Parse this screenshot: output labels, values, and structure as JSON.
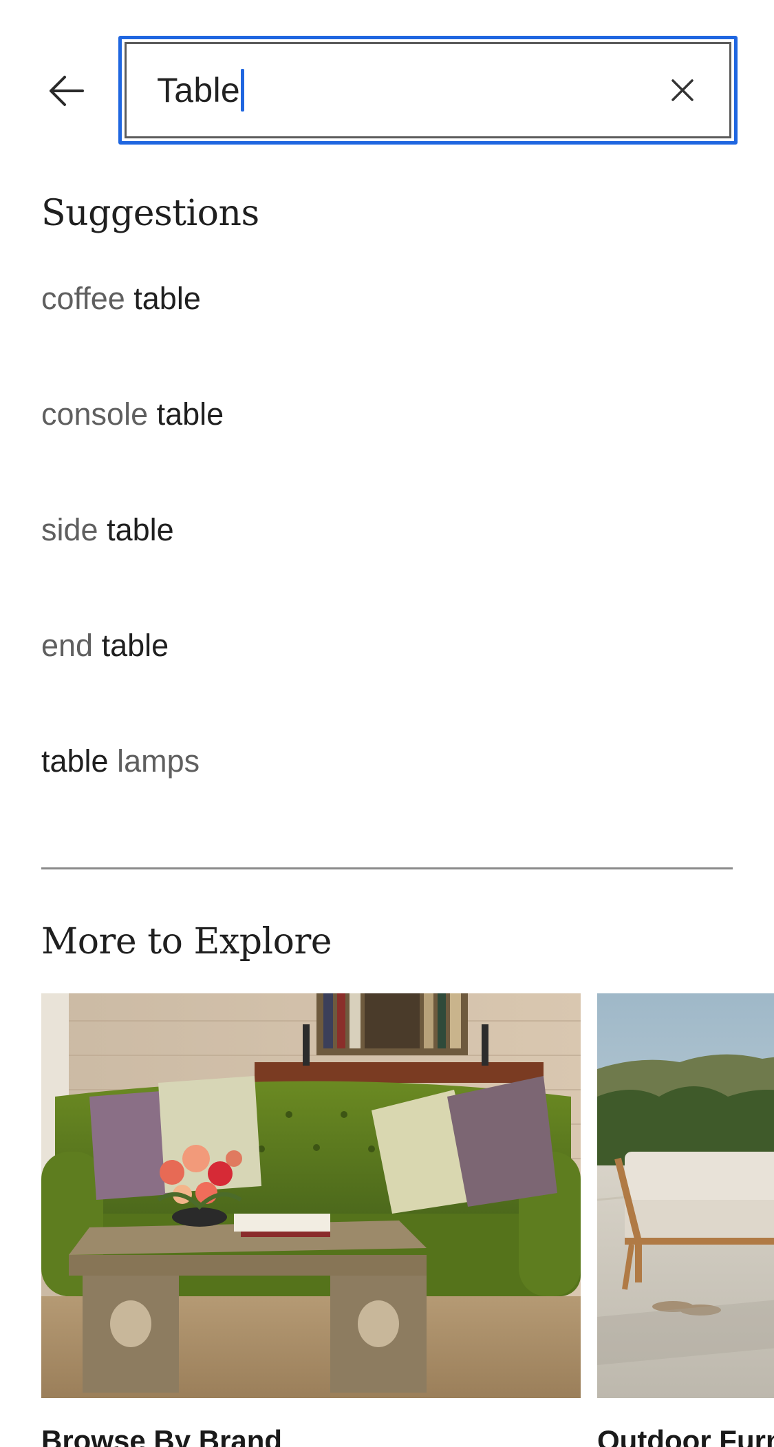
{
  "search": {
    "value": "Table",
    "back_icon": "arrow-left-icon",
    "clear_icon": "close-icon",
    "focus_color": "#1f66e0"
  },
  "suggestions": {
    "title": "Suggestions",
    "items": [
      {
        "before": "coffee ",
        "match": "table",
        "after": ""
      },
      {
        "before": "console ",
        "match": "table",
        "after": ""
      },
      {
        "before": "side ",
        "match": "table",
        "after": ""
      },
      {
        "before": "end ",
        "match": "table",
        "after": ""
      },
      {
        "before": "",
        "match": "table",
        "after": " lamps"
      }
    ]
  },
  "explore": {
    "title": "More to Explore",
    "cards": [
      {
        "label": "Browse By Brand"
      },
      {
        "label": "Outdoor Furniture"
      }
    ]
  }
}
